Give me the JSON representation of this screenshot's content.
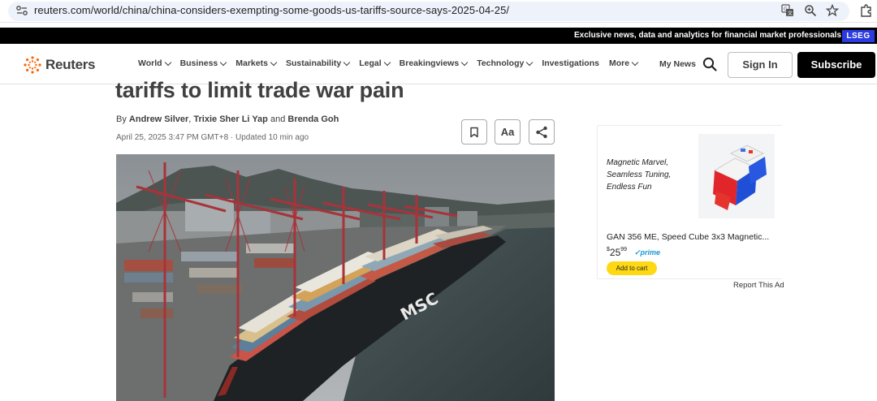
{
  "browser": {
    "url": "reuters.com/world/china/china-considers-exempting-some-goods-us-tariffs-source-says-2025-04-25/",
    "icons": [
      "site-info-icon",
      "translate-icon",
      "zoom-icon",
      "bookmark-star-icon",
      "extensions-icon"
    ]
  },
  "promo": {
    "text": "Exclusive news, data and analytics for financial market professionals",
    "badge": "LSEG",
    "badge_color": "#2b3bdf"
  },
  "nav": {
    "logo": "Reuters",
    "items": [
      {
        "label": "World"
      },
      {
        "label": "Business"
      },
      {
        "label": "Markets"
      },
      {
        "label": "Sustainability"
      },
      {
        "label": "Legal"
      },
      {
        "label": "Breakingviews"
      },
      {
        "label": "Technology"
      },
      {
        "label": "Investigations"
      },
      {
        "label": "More"
      }
    ],
    "my_news": "My News",
    "sign_in": "Sign In",
    "subscribe": "Subscribe"
  },
  "article": {
    "headline_fragment": "tariffs to limit trade war pain",
    "byline_prefix": "By",
    "authors": [
      "Andrew Silver",
      "Trixie Sher Li Yap",
      "Brenda Goh"
    ],
    "byline_and": "and",
    "date": "April 25, 2025 3:47 PM GMT+8 · Updated 10 min ago",
    "tools": {
      "font_size_label": "Aa"
    },
    "photo_ship_text": "MSC"
  },
  "ad": {
    "tagline": "Magnetic Marvel, Seamless Tuning, Endless Fun",
    "product_title": "GAN 356 ME, Speed Cube 3x3 Magnetic...",
    "price_currency": "$",
    "price_whole": "25",
    "price_cents": "99",
    "prime_label": "✓prime",
    "cart_button": "Add to cart",
    "report": "Report This Ad"
  }
}
